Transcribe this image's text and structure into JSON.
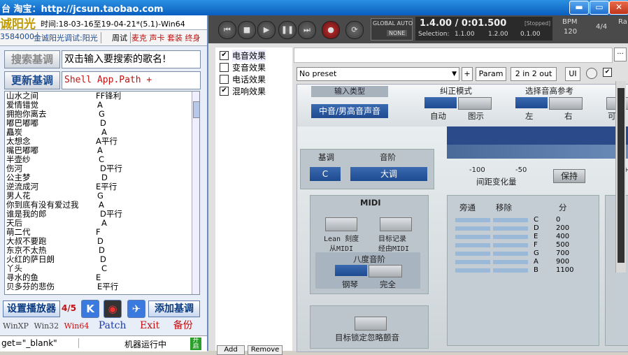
{
  "window": {
    "title": "台 淘宝：http://jcsun.taobao.com",
    "min_label": "▬",
    "max_label": "▭",
    "close_label": "✕"
  },
  "left": {
    "brand": "诚阳光",
    "time_info": "时间:18-03-16至19-04-21*(5.1)-Win64",
    "sub1": "3584000",
    "sub2": "金诚阳光调试:阳光",
    "sub3": "周试",
    "sub4": "麦克 声卡 套装 终身",
    "search_button": "搜索基调",
    "search_hint": "双击输入要搜索的歌名!",
    "update_button": "更新基调",
    "path_value": "Shell App.Path +",
    "songs": [
      {
        "name": "山水之间",
        "key": "FF锋利"
      },
      {
        "name": "爱情错觉",
        "key": "A"
      },
      {
        "name": "拥抱你离去",
        "key": "G"
      },
      {
        "name": "嘟巴嘟嘟",
        "key": "D"
      },
      {
        "name": "矗炭",
        "key": "A"
      },
      {
        "name": "太想念",
        "key": "A平行"
      },
      {
        "name": "嘴巴嘟嘟",
        "key": "A"
      },
      {
        "name": "半壶纱",
        "key": "C"
      },
      {
        "name": "伤河",
        "key": "D平行"
      },
      {
        "name": "公主梦",
        "key": "D"
      },
      {
        "name": "逆流成河",
        "key": "E平行"
      },
      {
        "name": "男人花",
        "key": "G"
      },
      {
        "name": "你到底有没有爱过我",
        "key": "A"
      },
      {
        "name": "谁是我的郎",
        "key": "D平行"
      },
      {
        "name": "天后",
        "key": "A"
      },
      {
        "name": "萌二代",
        "key": "F"
      },
      {
        "name": "大叔不要跑",
        "key": "D"
      },
      {
        "name": "东京不太热",
        "key": "D"
      },
      {
        "name": "火红的萨日朗",
        "key": "D"
      },
      {
        "name": "丫头",
        "key": "C"
      },
      {
        "name": "寻水的鱼",
        "key": "E"
      },
      {
        "name": "贝多芬的悲伤",
        "key": "E平行"
      }
    ],
    "player_button": "设置播放器",
    "page_count": "4/5",
    "add_key_button": "添加基调",
    "os1": "WinXP",
    "os2": "Win32",
    "os3": "Win64",
    "patch": "Patch",
    "exit": "Exit",
    "backup": "备份",
    "status_text": "get=\"_blank\"",
    "running_text": "机器运行中",
    "lock_label": "开启"
  },
  "transport": {
    "global_auto": "GLOBAL AUTO",
    "none": "NONE",
    "position": "1.4.00 / 0:01.500",
    "stopped": "[Stopped]",
    "selection_label": "Selection:",
    "sel1": "1.1.00",
    "sel2": "1.2.00",
    "sel3": "0.1.00",
    "bpm_label": "BPM",
    "bpm_value": "120",
    "time_sig": "4/4",
    "ra": "Ra"
  },
  "fx": [
    {
      "label": "电音效果",
      "checked": true
    },
    {
      "label": "变音效果",
      "checked": false
    },
    {
      "label": "电话效果",
      "checked": false
    },
    {
      "label": "混响效果",
      "checked": true
    }
  ],
  "fx_add": "Add",
  "fx_remove": "Remove",
  "plugin": {
    "preset": "No preset",
    "plus": "+",
    "param": "Param",
    "io": "2 in 2 out",
    "ui": "UI",
    "dots": "..."
  },
  "tune": {
    "input_type_label": "输入类型",
    "input_type_value": "中音/男高音声音",
    "correction_label": "纠正模式",
    "auto": "自动",
    "graph": "图示",
    "ref_label": "选择音高参考",
    "left": "左",
    "right": "右",
    "edge": "可",
    "key_label": "基调",
    "key_value": "C",
    "scale_label": "音阶",
    "scale_value": "大调",
    "axis_100": "-100",
    "axis_50": "-50",
    "axis_p": "+",
    "pitch_change": "间距变化量",
    "hold": "保持",
    "midi_label": "MIDI",
    "learn1": "Lean 刻度",
    "learn2": "从MIDI",
    "target1": "目标记录",
    "target2": "经由MIDI",
    "octave_label": "八度音阶",
    "piano": "钢琴",
    "complete": "完全",
    "bypass": "旁通",
    "shift": "移除",
    "cents": "分",
    "notes": [
      {
        "n": "C",
        "v": "0"
      },
      {
        "n": "D",
        "v": "200"
      },
      {
        "n": "E",
        "v": "400"
      },
      {
        "n": "F",
        "v": "500"
      },
      {
        "n": "G",
        "v": "700"
      },
      {
        "n": "A",
        "v": "900"
      },
      {
        "n": "B",
        "v": "1100"
      }
    ],
    "target_lock": "目标锁定忽略颤音"
  }
}
